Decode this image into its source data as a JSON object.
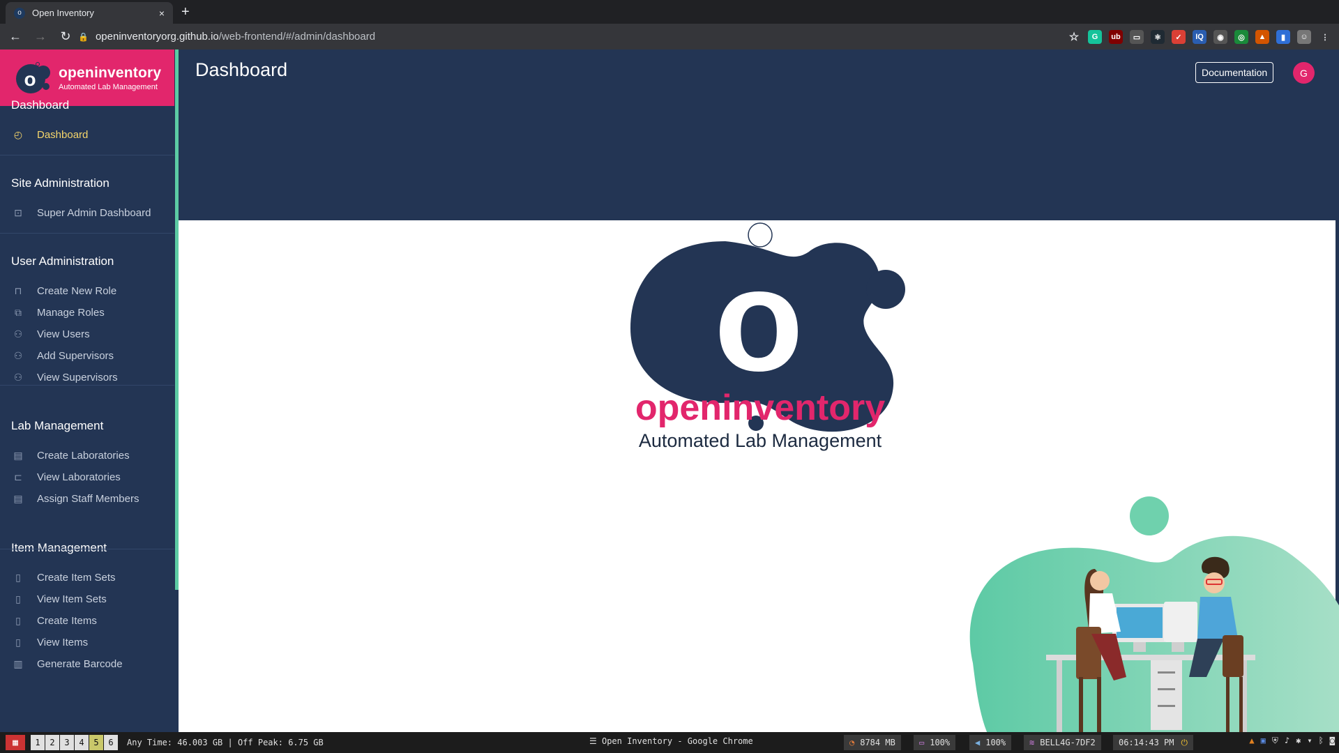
{
  "browser": {
    "tab_title": "Open Inventory",
    "tab_close": "×",
    "new_tab": "+",
    "url_host": "openinventoryorg.github.io",
    "url_path": "/web-frontend/#/admin/dashboard",
    "extensions": [
      {
        "name": "grammarly-icon",
        "color": "#15c39a",
        "label": "G"
      },
      {
        "name": "ublock-icon",
        "color": "#800000",
        "label": "ub"
      },
      {
        "name": "screen-icon",
        "color": "#555555",
        "label": "▭"
      },
      {
        "name": "react-devtools-icon",
        "color": "#1f2a33",
        "label": "⚛"
      },
      {
        "name": "todoist-icon",
        "color": "#db4035",
        "label": "✓"
      },
      {
        "name": "iq-icon",
        "color": "#2a5db0",
        "label": "IQ"
      },
      {
        "name": "extension-icon",
        "color": "#555555",
        "label": "◉"
      },
      {
        "name": "target-icon",
        "color": "#1a8a3a",
        "label": "◎"
      },
      {
        "name": "fire-icon",
        "color": "#d45500",
        "label": "▲"
      },
      {
        "name": "bookmark-ext-icon",
        "color": "#2f6fd6",
        "label": "▮"
      },
      {
        "name": "profile-icon",
        "color": "#777777",
        "label": "☺"
      }
    ]
  },
  "brand": {
    "name": "openinventory",
    "subtitle": "Automated Lab Management",
    "logo_letter": "o"
  },
  "sidebar": {
    "sections": [
      {
        "heading": "Dashboard",
        "items": [
          {
            "label": "Dashboard",
            "icon": "dashboard-icon",
            "active": true
          }
        ]
      },
      {
        "heading": "Site Administration",
        "items": [
          {
            "label": "Super Admin Dashboard",
            "icon": "terminal-icon"
          }
        ]
      },
      {
        "heading": "User Administration",
        "items": [
          {
            "label": "Create New Role",
            "icon": "lock-icon"
          },
          {
            "label": "Manage Roles",
            "icon": "roles-icon"
          },
          {
            "label": "View Users",
            "icon": "user-icon"
          },
          {
            "label": "Add Supervisors",
            "icon": "user-icon"
          },
          {
            "label": "View Supervisors",
            "icon": "user-icon"
          }
        ]
      },
      {
        "heading": "Lab Management",
        "items": [
          {
            "label": "Create Laboratories",
            "icon": "id-card-icon"
          },
          {
            "label": "View Laboratories",
            "icon": "laptop-icon"
          },
          {
            "label": "Assign Staff Members",
            "icon": "id-card-icon"
          }
        ]
      },
      {
        "heading": "Item Management",
        "items": [
          {
            "label": "Create Item Sets",
            "icon": "file-icon"
          },
          {
            "label": "View Item Sets",
            "icon": "file-icon"
          },
          {
            "label": "Create Items",
            "icon": "file-icon"
          },
          {
            "label": "View Items",
            "icon": "file-icon"
          },
          {
            "label": "Generate Barcode",
            "icon": "barcode-icon"
          }
        ]
      }
    ]
  },
  "header": {
    "title": "Dashboard",
    "documentation_button": "Documentation",
    "avatar_letter": "G"
  },
  "hero": {
    "name": "openinventory",
    "subtitle": "Automated Lab Management",
    "logo_letter": "o"
  },
  "taskbar": {
    "workspaces": [
      "1",
      "2",
      "3",
      "4",
      "5",
      "6"
    ],
    "current_workspace": "5",
    "usage": "Any Time: 46.003 GB | Off Peak: 6.75 GB",
    "window_title": "Open Inventory - Google Chrome",
    "memory": "8784 MB",
    "battery": "100%",
    "volume": "100%",
    "wifi": "BELL4G-7DF2",
    "clock": "06:14:43 PM"
  }
}
